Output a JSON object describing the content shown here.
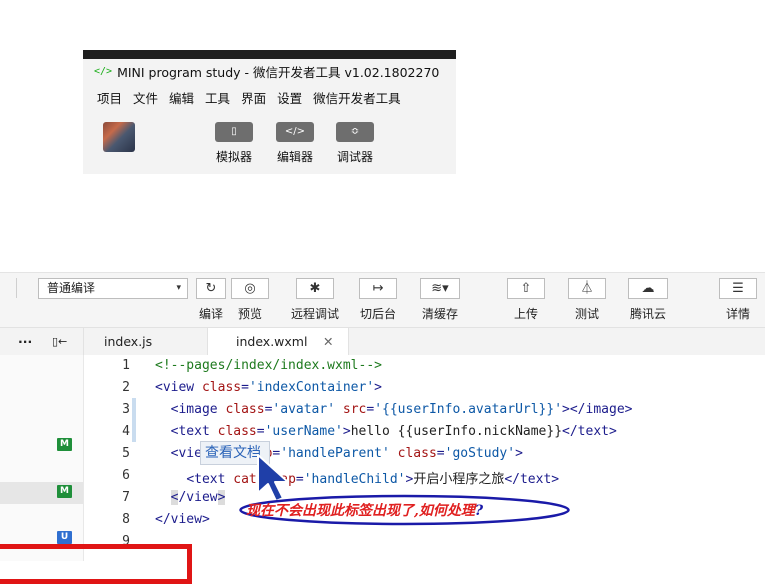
{
  "inset": {
    "cut_text": "── ─── ─ ─── ─── ─── ── ─── ──",
    "app_icon": "</>",
    "title": "MINI program study - 微信开发者工具 v1.02.1802270",
    "menu": [
      "项目",
      "文件",
      "编辑",
      "工具",
      "界面",
      "设置",
      "微信开发者工具"
    ],
    "tools": [
      {
        "icon": "▯",
        "label": "模拟器"
      },
      {
        "icon": "</>",
        "label": "编辑器"
      },
      {
        "icon": "≎",
        "label": "调试器"
      }
    ]
  },
  "toolbar": {
    "compile_mode": "普通编译",
    "caret": "▾",
    "buttons": [
      {
        "icon": "↻",
        "label": "编译"
      },
      {
        "icon": "◎",
        "label": "预览"
      },
      {
        "icon": "✱",
        "label": "远程调试"
      },
      {
        "icon": "↦",
        "label": "切后台"
      },
      {
        "icon": "≋▾",
        "label": "清缓存"
      },
      {
        "icon": "⇧",
        "label": "上传"
      },
      {
        "icon": "⏃",
        "label": "测试"
      },
      {
        "icon": "☁",
        "label": "腾讯云"
      },
      {
        "icon": "☰",
        "label": "详情"
      }
    ]
  },
  "tabs": {
    "more": "···",
    "collapse": "▯←",
    "files": [
      "index.js",
      "index.wxml"
    ],
    "close": "✕"
  },
  "sidebar": {
    "badges": [
      "M",
      "M",
      "U"
    ]
  },
  "editor": {
    "line_numbers": [
      "1",
      "2",
      "3",
      "4",
      "5",
      "6",
      "7",
      "8",
      "9"
    ]
  },
  "tooltip": "查看文档",
  "annotation": {
    "text": "现在不会出现此标签出现了,如何处理",
    "q": "?"
  },
  "colors": {
    "annotation_red": "#e02020",
    "bubble_border": "#1a1aa8",
    "badge_green": "#1f8f3a",
    "badge_blue": "#2f6fd0",
    "red_box": "#e01515"
  }
}
